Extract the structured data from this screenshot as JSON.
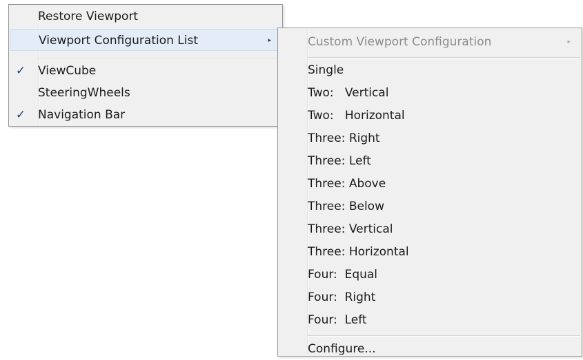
{
  "context_menu": {
    "items": [
      {
        "label": "Restore Viewport",
        "checked": false
      },
      {
        "label": "Viewport Configuration List",
        "checked": false,
        "submenu": true
      },
      {
        "label": "ViewCube",
        "checked": true
      },
      {
        "label": "SteeringWheels",
        "checked": false
      },
      {
        "label": "Navigation Bar",
        "checked": true
      }
    ],
    "check_glyph": "✓",
    "arrow_glyph": "▸"
  },
  "submenu": {
    "header": {
      "label": "Custom Viewport Configuration",
      "disabled": true
    },
    "items": [
      {
        "label": "Single"
      },
      {
        "label": "Two:   Vertical"
      },
      {
        "label": "Two:   Horizontal"
      },
      {
        "label": "Three: Right"
      },
      {
        "label": "Three: Left"
      },
      {
        "label": "Three: Above"
      },
      {
        "label": "Three: Below"
      },
      {
        "label": "Three: Vertical"
      },
      {
        "label": "Three: Horizontal"
      },
      {
        "label": "Four:  Equal"
      },
      {
        "label": "Four:  Right"
      },
      {
        "label": "Four:  Left"
      }
    ],
    "footer": {
      "label": "Configure..."
    }
  },
  "colors": {
    "menu_bg": "#f0f0f0",
    "border": "#979797",
    "highlight": "#e3ecf7",
    "check": "#1d3c7a",
    "disabled_text": "#8c8c8c"
  }
}
